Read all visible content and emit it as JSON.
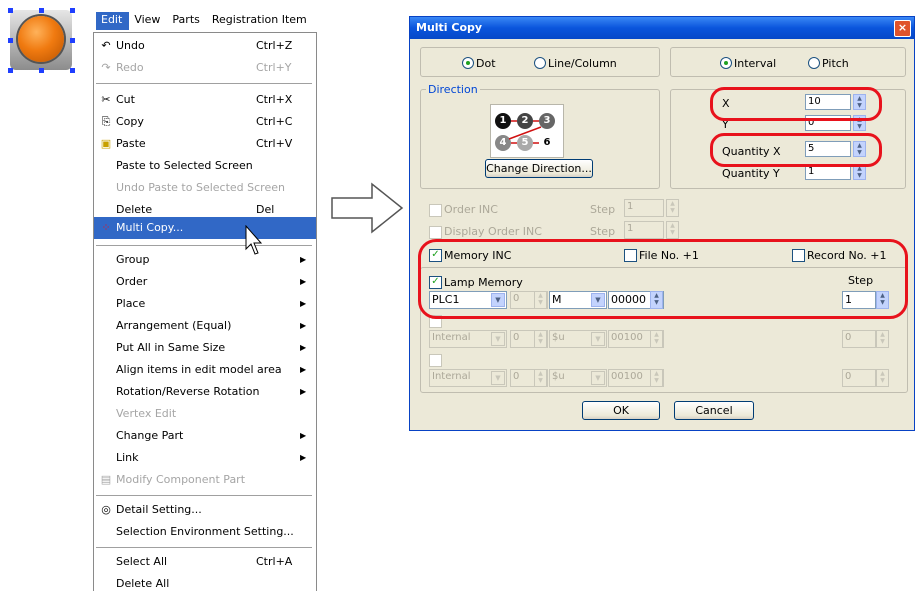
{
  "menubar": {
    "items": [
      "Edit",
      "View",
      "Parts",
      "Registration Item"
    ]
  },
  "menu": {
    "items": [
      {
        "label": "Undo",
        "shortcut": "Ctrl+Z",
        "icon": "undo-icon",
        "disabled": false
      },
      {
        "label": "Redo",
        "shortcut": "Ctrl+Y",
        "icon": "redo-icon",
        "disabled": true
      },
      {
        "label": "Cut",
        "shortcut": "Ctrl+X",
        "icon": "scissors-icon",
        "disabled": false
      },
      {
        "label": "Copy",
        "shortcut": "Ctrl+C",
        "icon": "copy-icon",
        "disabled": false
      },
      {
        "label": "Paste",
        "shortcut": "Ctrl+V",
        "icon": "clipboard-icon",
        "disabled": false
      },
      {
        "label": "Paste to Selected Screen",
        "disabled": false
      },
      {
        "label": "Undo Paste to Selected Screen",
        "disabled": true
      },
      {
        "label": "Delete",
        "shortcut": "Del",
        "disabled": false
      },
      {
        "label": "Multi Copy...",
        "icon": "multi-copy-icon",
        "disabled": false,
        "highlighted": true
      },
      {
        "label": "Group",
        "submenu": true
      },
      {
        "label": "Order",
        "submenu": true
      },
      {
        "label": "Place",
        "submenu": true
      },
      {
        "label": "Arrangement (Equal)",
        "submenu": true
      },
      {
        "label": "Put All in Same Size",
        "submenu": true
      },
      {
        "label": "Align items in edit model area",
        "submenu": true
      },
      {
        "label": "Rotation/Reverse Rotation",
        "submenu": true
      },
      {
        "label": "Vertex Edit",
        "disabled": true
      },
      {
        "label": "Change Part",
        "submenu": true
      },
      {
        "label": "Link",
        "submenu": true
      },
      {
        "label": "Modify Component Part",
        "icon": "component-icon",
        "disabled": true
      },
      {
        "label": "Detail Setting...",
        "icon": "detail-icon"
      },
      {
        "label": "Selection Environment Setting..."
      },
      {
        "label": "Select All",
        "shortcut": "Ctrl+A"
      },
      {
        "label": "Delete All"
      }
    ]
  },
  "dialog": {
    "title": "Multi Copy",
    "close": "×",
    "mode": {
      "dot": "Dot",
      "line_column": "Line/Column"
    },
    "spacing": {
      "interval": "Interval",
      "pitch": "Pitch"
    },
    "direction": {
      "title": "Direction",
      "button": "Change Direction..."
    },
    "direction_digits": [
      "1",
      "2",
      "3",
      "4",
      "5",
      "6"
    ],
    "params": {
      "x_label": "X",
      "x_value": "10",
      "y_label": "Y",
      "y_value": "0",
      "qx_label": "Quantity X",
      "qx_value": "5",
      "qy_label": "Quantity Y",
      "qy_value": "1"
    },
    "order_inc": {
      "label": "Order INC",
      "step_label": "Step",
      "step": "1"
    },
    "display_order_inc": {
      "label": "Display Order INC",
      "step_label": "Step",
      "step": "1"
    },
    "memory_inc": {
      "label": "Memory INC",
      "checked": "✓"
    },
    "file_no": {
      "label": "File No. +1"
    },
    "record_no": {
      "label": "Record No. +1"
    },
    "lamp_memory": {
      "label": "Lamp Memory",
      "checked": "✓",
      "step_label": "Step",
      "device": "PLC1",
      "station": "0",
      "memory": "M",
      "address": "00000",
      "step": "1"
    },
    "row2": {
      "device": "Internal",
      "station": "0",
      "memory": "$u",
      "address": "00100",
      "step": "0"
    },
    "row3": {
      "device": "Internal",
      "station": "0",
      "memory": "$u",
      "address": "00100",
      "step": "0"
    },
    "buttons": {
      "ok": "OK",
      "cancel": "Cancel"
    }
  },
  "colors": {
    "highlight": "#3168c6",
    "annotation_ring": "#e8121c",
    "title_bar": "#0a55dc"
  }
}
